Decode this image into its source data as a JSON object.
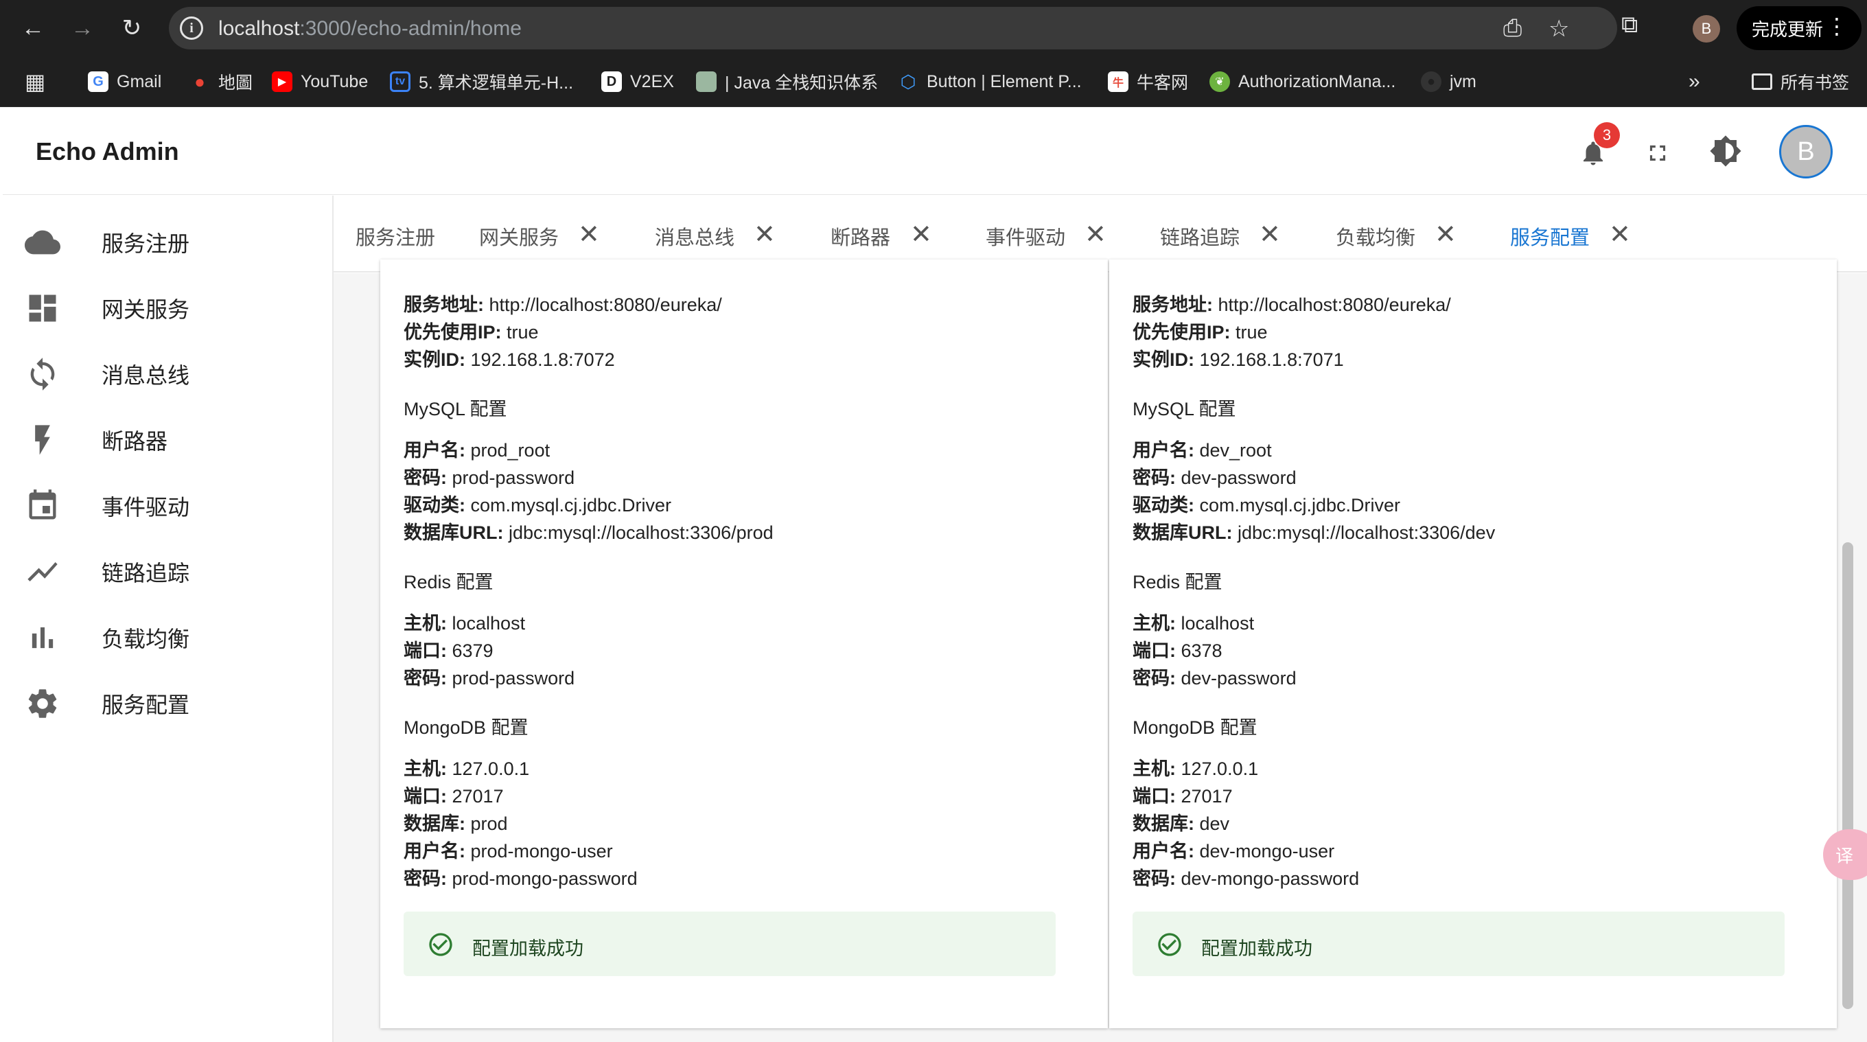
{
  "browser": {
    "url_host": "localhost",
    "url_rest": ":3000/echo-admin/home",
    "profile_initial": "B",
    "update_label": "完成更新",
    "bookmarks": [
      {
        "label": "Gmail",
        "icon": "gmail-icon"
      },
      {
        "label": "地圖",
        "icon": "maps-icon"
      },
      {
        "label": "YouTube",
        "icon": "youtube-icon"
      },
      {
        "label": "5. 算术逻辑单元-H...",
        "icon": "bilibili-icon"
      },
      {
        "label": "V2EX",
        "icon": "v2ex-icon"
      },
      {
        "label": "| Java 全栈知识体系",
        "icon": "java-icon"
      },
      {
        "label": "Button | Element P...",
        "icon": "element-icon"
      },
      {
        "label": "牛客网",
        "icon": "nowcoder-icon"
      },
      {
        "label": "AuthorizationMana...",
        "icon": "leaf-icon"
      },
      {
        "label": "jvm",
        "icon": "github-icon"
      }
    ],
    "all_bookmarks_label": "所有书签"
  },
  "app": {
    "title": "Echo Admin",
    "notification_count": "3",
    "avatar_initial": "B"
  },
  "sidebar": {
    "items": [
      {
        "label": "服务注册",
        "icon": "cloud-icon"
      },
      {
        "label": "网关服务",
        "icon": "dashboard-icon"
      },
      {
        "label": "消息总线",
        "icon": "sync-icon"
      },
      {
        "label": "断路器",
        "icon": "bolt-icon"
      },
      {
        "label": "事件驱动",
        "icon": "calendar-icon"
      },
      {
        "label": "链路追踪",
        "icon": "timeline-icon"
      },
      {
        "label": "负载均衡",
        "icon": "bar-chart-icon"
      },
      {
        "label": "服务配置",
        "icon": "settings-icon"
      }
    ]
  },
  "tabs": [
    {
      "label": "服务注册",
      "closable": false
    },
    {
      "label": "网关服务",
      "closable": true
    },
    {
      "label": "消息总线",
      "closable": true
    },
    {
      "label": "断路器",
      "closable": true
    },
    {
      "label": "事件驱动",
      "closable": true
    },
    {
      "label": "链路追踪",
      "closable": true
    },
    {
      "label": "负载均衡",
      "closable": true
    },
    {
      "label": "服务配置",
      "closable": true,
      "active": true
    }
  ],
  "close_glyph": "✕",
  "cards": [
    {
      "eureka": [
        {
          "key": "服务地址:",
          "value": " http://localhost:8080/eureka/"
        },
        {
          "key": "优先使用IP:",
          "value": " true"
        },
        {
          "key": "实例ID:",
          "value": " 192.168.1.8:7072"
        }
      ],
      "mysql_title": "MySQL 配置",
      "mysql": [
        {
          "key": "用户名:",
          "value": " prod_root"
        },
        {
          "key": "密码:",
          "value": " prod-password"
        },
        {
          "key": "驱动类:",
          "value": " com.mysql.cj.jdbc.Driver"
        },
        {
          "key": "数据库URL:",
          "value": " jdbc:mysql://localhost:3306/prod"
        }
      ],
      "redis_title": "Redis 配置",
      "redis": [
        {
          "key": "主机:",
          "value": " localhost"
        },
        {
          "key": "端口:",
          "value": " 6379"
        },
        {
          "key": "密码:",
          "value": " prod-password"
        }
      ],
      "mongo_title": "MongoDB 配置",
      "mongo": [
        {
          "key": "主机:",
          "value": " 127.0.0.1"
        },
        {
          "key": "端口:",
          "value": " 27017"
        },
        {
          "key": "数据库:",
          "value": " prod"
        },
        {
          "key": "用户名:",
          "value": " prod-mongo-user"
        },
        {
          "key": "密码:",
          "value": " prod-mongo-password"
        }
      ],
      "status": "配置加载成功"
    },
    {
      "eureka": [
        {
          "key": "服务地址:",
          "value": " http://localhost:8080/eureka/"
        },
        {
          "key": "优先使用IP:",
          "value": " true"
        },
        {
          "key": "实例ID:",
          "value": " 192.168.1.8:7071"
        }
      ],
      "mysql_title": "MySQL 配置",
      "mysql": [
        {
          "key": "用户名:",
          "value": " dev_root"
        },
        {
          "key": "密码:",
          "value": " dev-password"
        },
        {
          "key": "驱动类:",
          "value": " com.mysql.cj.jdbc.Driver"
        },
        {
          "key": "数据库URL:",
          "value": " jdbc:mysql://localhost:3306/dev"
        }
      ],
      "redis_title": "Redis 配置",
      "redis": [
        {
          "key": "主机:",
          "value": " localhost"
        },
        {
          "key": "端口:",
          "value": " 6378"
        },
        {
          "key": "密码:",
          "value": " dev-password"
        }
      ],
      "mongo_title": "MongoDB 配置",
      "mongo": [
        {
          "key": "主机:",
          "value": " 127.0.0.1"
        },
        {
          "key": "端口:",
          "value": " 27017"
        },
        {
          "key": "数据库:",
          "value": " dev"
        },
        {
          "key": "用户名:",
          "value": " dev-mongo-user"
        },
        {
          "key": "密码:",
          "value": " dev-mongo-password"
        }
      ],
      "status": "配置加载成功"
    }
  ],
  "colors": {
    "accent": "#1976d2",
    "badge": "#e53935",
    "success_bg": "#edf7ed",
    "success_icon": "#2e7d32"
  }
}
